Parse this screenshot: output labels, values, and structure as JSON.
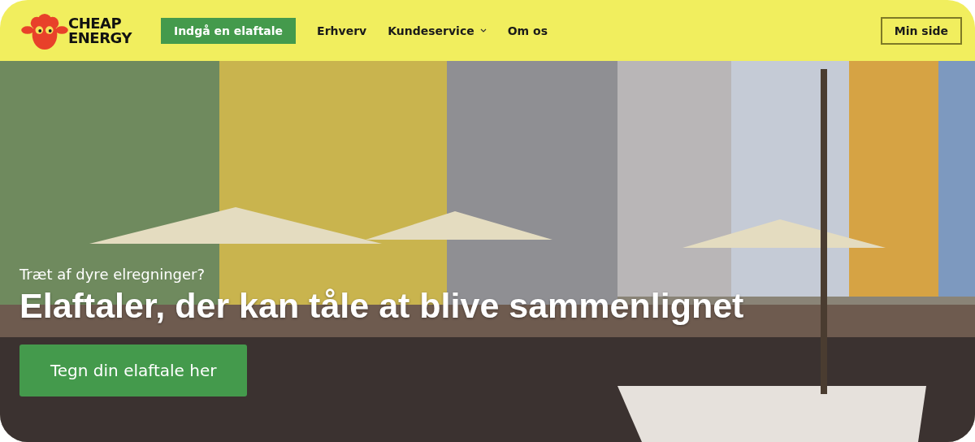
{
  "header": {
    "logo": [
      "CHEAP",
      "ENERGY"
    ],
    "nav": [
      {
        "label": "Indgå en elaftale",
        "kind": "cta"
      },
      {
        "label": "Erhverv",
        "kind": "link"
      },
      {
        "label": "Kundeservice",
        "kind": "dropdown"
      },
      {
        "label": "Om os",
        "kind": "link"
      }
    ],
    "account_button": "Min side"
  },
  "hero": {
    "kicker": "Træt af dyre elregninger?",
    "title": "Elaftaler, der kan tåle at blive sammenlignet",
    "button": "Tegn din elaftale her"
  }
}
